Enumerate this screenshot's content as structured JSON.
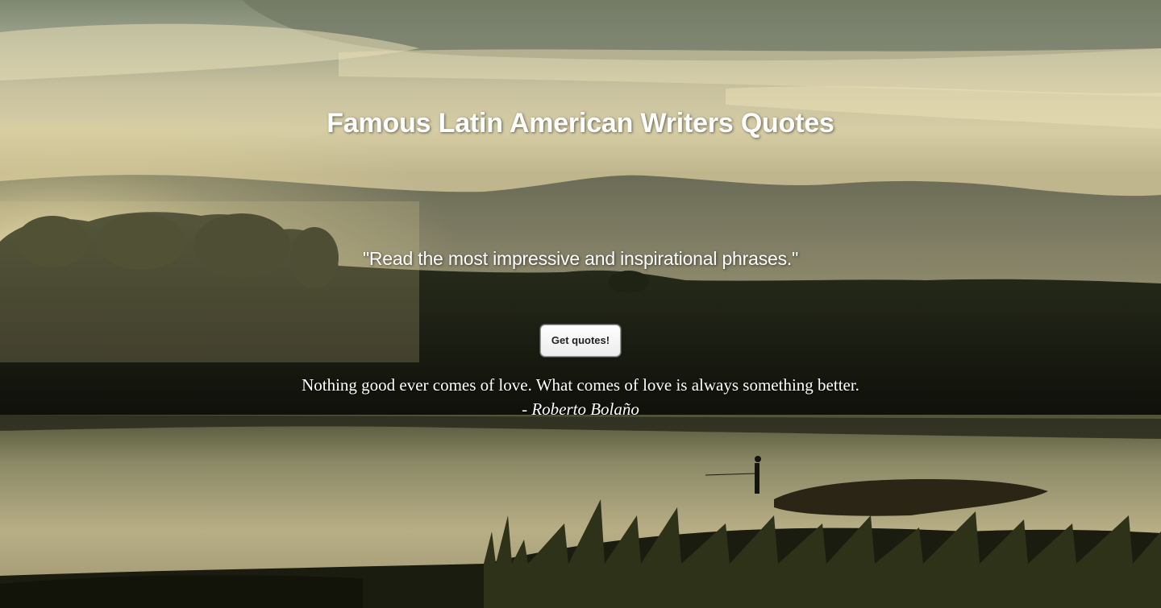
{
  "page": {
    "title": "Famous Latin American Writers Quotes",
    "subtitle": "\"Read the most impressive and inspirational phrases.\""
  },
  "actions": {
    "get_quotes_label": "Get quotes!"
  },
  "quote": {
    "text": "Nothing good ever comes of love. What comes of love is always something better.",
    "author_prefix": "- ",
    "author": "Roberto Bolaño"
  },
  "background": {
    "scene": "lakeside-sunset-photo"
  }
}
